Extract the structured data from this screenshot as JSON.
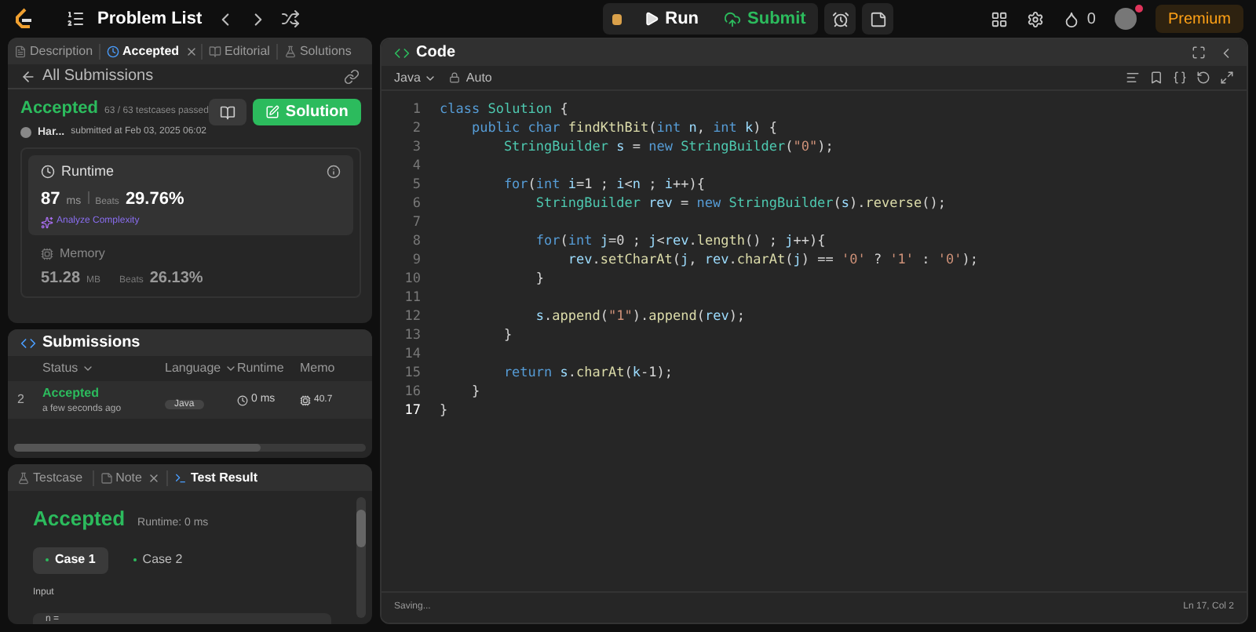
{
  "topbar": {
    "title": "Problem List",
    "run": "Run",
    "submit": "Submit",
    "coins": "0",
    "premium": "Premium"
  },
  "left_tabs": [
    {
      "label": "Description",
      "selected": false,
      "closable": false
    },
    {
      "label": "Accepted",
      "selected": true,
      "closable": true
    },
    {
      "label": "Editorial",
      "selected": false,
      "closable": false
    },
    {
      "label": "Solutions",
      "selected": false,
      "closable": false
    }
  ],
  "submission": {
    "back": "All Submissions",
    "status": "Accepted",
    "passed": "63 / 63 testcases passed",
    "user": "Har...",
    "submitted": "submitted at Feb 03, 2025 06:02",
    "solution_button": "Solution",
    "runtime": {
      "label": "Runtime",
      "value": "87",
      "unit": "ms",
      "beats_label": "Beats",
      "beats": "29.76%",
      "analyze": "Analyze Complexity"
    },
    "memory": {
      "label": "Memory",
      "value": "51.28",
      "unit": "MB",
      "beats_label": "Beats",
      "beats": "26.13%"
    }
  },
  "submissions": {
    "title": "Submissions",
    "columns": [
      "Status",
      "Language",
      "Runtime",
      "Memo"
    ],
    "rows": [
      {
        "index": "2",
        "status": "Accepted",
        "time": "a few seconds ago",
        "language": "Java",
        "runtime": "0 ms",
        "memory": "40.7"
      }
    ]
  },
  "bottom_tabs": [
    {
      "label": "Testcase",
      "selected": false,
      "closable": false
    },
    {
      "label": "Note",
      "selected": false,
      "closable": true
    },
    {
      "label": "Test Result",
      "selected": true,
      "closable": false
    }
  ],
  "result": {
    "status": "Accepted",
    "runtime": "Runtime: 0 ms",
    "cases": [
      {
        "label": "Case 1",
        "selected": true
      },
      {
        "label": "Case 2",
        "selected": false
      }
    ],
    "input_label": "Input",
    "input_value": "n ="
  },
  "editor": {
    "title": "Code",
    "language": "Java",
    "mode": "Auto",
    "status": "Saving...",
    "cursor": "Ln 17, Col 2",
    "lines": [
      {
        "num": "1",
        "current": false,
        "tokens": [
          {
            "t": "class ",
            "kind": "kw"
          },
          {
            "t": "Solution",
            "kind": "type"
          },
          {
            "t": " {",
            "kind": "plain"
          }
        ]
      },
      {
        "num": "2",
        "current": false,
        "tokens": [
          {
            "t": "    public char ",
            "kind": "kw"
          },
          {
            "t": "findKthBit",
            "kind": "fn"
          },
          {
            "t": "(",
            "kind": "plain"
          },
          {
            "t": "int ",
            "kind": "kw"
          },
          {
            "t": "n",
            "kind": "var"
          },
          {
            "t": ", ",
            "kind": "plain"
          },
          {
            "t": "int ",
            "kind": "kw"
          },
          {
            "t": "k",
            "kind": "var"
          },
          {
            "t": ") {",
            "kind": "plain"
          }
        ]
      },
      {
        "num": "3",
        "current": false,
        "tokens": [
          {
            "t": "        StringBuilder ",
            "kind": "type"
          },
          {
            "t": "s",
            "kind": "var"
          },
          {
            "t": " = ",
            "kind": "plain"
          },
          {
            "t": "new ",
            "kind": "kw"
          },
          {
            "t": "StringBuilder",
            "kind": "type"
          },
          {
            "t": "(",
            "kind": "plain"
          },
          {
            "t": "\"0\"",
            "kind": "str"
          },
          {
            "t": ");",
            "kind": "plain"
          }
        ]
      },
      {
        "num": "4",
        "current": false
      },
      {
        "num": "5",
        "current": false,
        "tokens": [
          {
            "t": "        for",
            "kind": "kw"
          },
          {
            "t": "(",
            "kind": "plain"
          },
          {
            "t": "int ",
            "kind": "kw"
          },
          {
            "t": "i",
            "kind": "var"
          },
          {
            "t": "=1 ; ",
            "kind": "plain"
          },
          {
            "t": "i",
            "kind": "var"
          },
          {
            "t": "<",
            "kind": "plain"
          },
          {
            "t": "n",
            "kind": "var"
          },
          {
            "t": " ; ",
            "kind": "plain"
          },
          {
            "t": "i",
            "kind": "var"
          },
          {
            "t": "++){",
            "kind": "plain"
          }
        ]
      },
      {
        "num": "6",
        "current": false,
        "tokens": [
          {
            "t": "            StringBuilder ",
            "kind": "type"
          },
          {
            "t": "rev",
            "kind": "var"
          },
          {
            "t": " = ",
            "kind": "plain"
          },
          {
            "t": "new ",
            "kind": "kw"
          },
          {
            "t": "StringBuilder",
            "kind": "type"
          },
          {
            "t": "(",
            "kind": "plain"
          },
          {
            "t": "s",
            "kind": "var"
          },
          {
            "t": ").",
            "kind": "plain"
          },
          {
            "t": "reverse",
            "kind": "fn"
          },
          {
            "t": "();",
            "kind": "plain"
          }
        ]
      },
      {
        "num": "7",
        "current": false
      },
      {
        "num": "8",
        "current": false,
        "tokens": [
          {
            "t": "            for",
            "kind": "kw"
          },
          {
            "t": "(",
            "kind": "plain"
          },
          {
            "t": "int ",
            "kind": "kw"
          },
          {
            "t": "j",
            "kind": "var"
          },
          {
            "t": "=0 ; ",
            "kind": "plain"
          },
          {
            "t": "j",
            "kind": "var"
          },
          {
            "t": "<",
            "kind": "plain"
          },
          {
            "t": "rev",
            "kind": "var"
          },
          {
            "t": ".",
            "kind": "plain"
          },
          {
            "t": "length",
            "kind": "fn"
          },
          {
            "t": "() ; ",
            "kind": "plain"
          },
          {
            "t": "j",
            "kind": "var"
          },
          {
            "t": "++){",
            "kind": "plain"
          }
        ]
      },
      {
        "num": "9",
        "current": false,
        "tokens": [
          {
            "t": "                rev",
            "kind": "var"
          },
          {
            "t": ".",
            "kind": "plain"
          },
          {
            "t": "setCharAt",
            "kind": "fn"
          },
          {
            "t": "(",
            "kind": "plain"
          },
          {
            "t": "j",
            "kind": "var"
          },
          {
            "t": ", ",
            "kind": "plain"
          },
          {
            "t": "rev",
            "kind": "var"
          },
          {
            "t": ".",
            "kind": "plain"
          },
          {
            "t": "charAt",
            "kind": "fn"
          },
          {
            "t": "(",
            "kind": "plain"
          },
          {
            "t": "j",
            "kind": "var"
          },
          {
            "t": ") == ",
            "kind": "plain"
          },
          {
            "t": "'0'",
            "kind": "str"
          },
          {
            "t": " ? ",
            "kind": "plain"
          },
          {
            "t": "'1'",
            "kind": "str"
          },
          {
            "t": " : ",
            "kind": "plain"
          },
          {
            "t": "'0'",
            "kind": "str"
          },
          {
            "t": ");",
            "kind": "plain"
          }
        ]
      },
      {
        "num": "10",
        "current": false,
        "tokens": [
          {
            "t": "            }",
            "kind": "plain"
          }
        ]
      },
      {
        "num": "11",
        "current": false
      },
      {
        "num": "12",
        "current": false,
        "tokens": [
          {
            "t": "            s",
            "kind": "var"
          },
          {
            "t": ".",
            "kind": "plain"
          },
          {
            "t": "append",
            "kind": "fn"
          },
          {
            "t": "(",
            "kind": "plain"
          },
          {
            "t": "\"1\"",
            "kind": "str"
          },
          {
            "t": ").",
            "kind": "plain"
          },
          {
            "t": "append",
            "kind": "fn"
          },
          {
            "t": "(",
            "kind": "plain"
          },
          {
            "t": "rev",
            "kind": "var"
          },
          {
            "t": ");",
            "kind": "plain"
          }
        ]
      },
      {
        "num": "13",
        "current": false,
        "tokens": [
          {
            "t": "        }",
            "kind": "plain"
          }
        ]
      },
      {
        "num": "14",
        "current": false
      },
      {
        "num": "15",
        "current": false,
        "tokens": [
          {
            "t": "        return ",
            "kind": "kw"
          },
          {
            "t": "s",
            "kind": "var"
          },
          {
            "t": ".",
            "kind": "plain"
          },
          {
            "t": "charAt",
            "kind": "fn"
          },
          {
            "t": "(",
            "kind": "plain"
          },
          {
            "t": "k",
            "kind": "var"
          },
          {
            "t": "-1);",
            "kind": "plain"
          }
        ]
      },
      {
        "num": "16",
        "current": false,
        "tokens": [
          {
            "t": "    }",
            "kind": "plain"
          }
        ]
      },
      {
        "num": "17",
        "current": true,
        "tokens": [
          {
            "t": "}",
            "kind": "plain"
          }
        ]
      }
    ]
  }
}
